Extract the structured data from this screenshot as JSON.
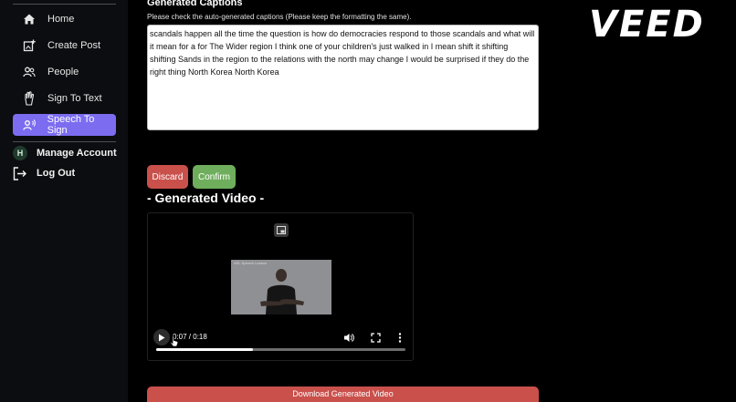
{
  "sidebar": {
    "items": [
      {
        "label": "Home",
        "icon": "home-icon"
      },
      {
        "label": "Create Post",
        "icon": "add-post-icon"
      },
      {
        "label": "People",
        "icon": "people-icon"
      },
      {
        "label": "Sign To Text",
        "icon": "hand-sign-icon"
      },
      {
        "label": "Speech To Sign",
        "icon": "speech-icon",
        "active": true
      }
    ],
    "account": {
      "avatar_initial": "H",
      "label": "Manage Account"
    },
    "logout": {
      "label": "Log Out",
      "icon": "logout-icon"
    },
    "active_color": "#7b6cf0"
  },
  "main": {
    "section_title": "Generated Captions",
    "hint": "Please check the auto-generated captions (Please keep the formatting the same).",
    "captions_text": "scandals happen all the time the question is how do democracies respond to those scandals and what will it mean for a for The Wider region I think one of your children's just walked in I mean shift it shifting shifting Sands in the region to the relations with the north may change I would be surprised if they do the right thing North Korea North Korea",
    "discard_label": "Discard",
    "confirm_label": "Confirm",
    "generated_title": "- Generated Video -",
    "video": {
      "frame_caption": "ASL Speech Lesson",
      "time": "0:07 / 0:18",
      "progress": 0.39
    },
    "download_label": "Download Generated Video",
    "colors": {
      "discard": "#c9504b",
      "confirm": "#6fae5c",
      "download": "#c9504b"
    }
  },
  "brand": {
    "logo": "VEED"
  }
}
